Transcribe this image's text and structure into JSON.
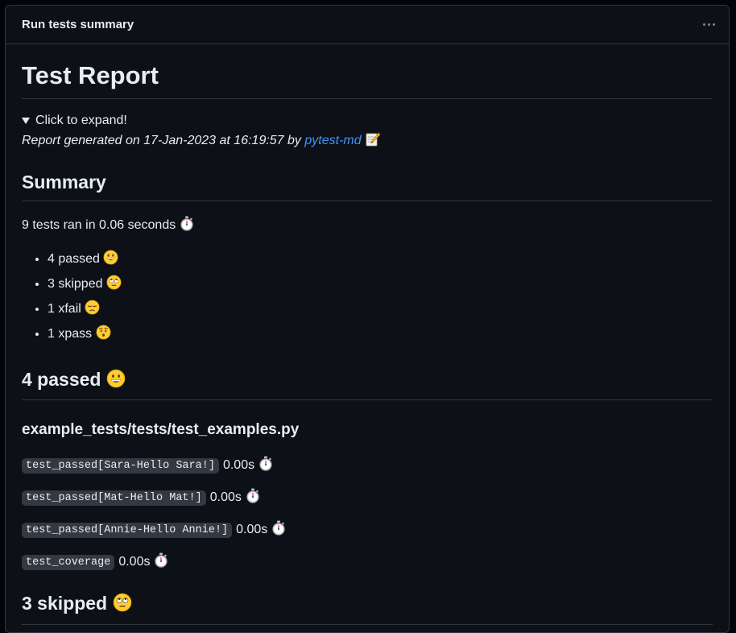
{
  "panel": {
    "title": "Run tests summary",
    "menu_icon": "kebab-horizontal-icon"
  },
  "report": {
    "title": "Test Report",
    "details_summary": "Click to expand!",
    "generated_prefix": "Report generated on 17-Jan-2023 at 16:19:57 by",
    "generated_link": "pytest-md",
    "generated_icon": "memo-icon"
  },
  "summary": {
    "heading": "Summary",
    "ran_text": "9 tests ran in 0.06 seconds",
    "items": [
      {
        "label": "4 passed",
        "icon": "grinning-face-icon"
      },
      {
        "label": "3 skipped",
        "icon": "rolling-eyes-face-icon"
      },
      {
        "label": "1 xfail",
        "icon": "pensive-face-icon"
      },
      {
        "label": "1 xpass",
        "icon": "hushed-face-icon"
      }
    ]
  },
  "passed": {
    "heading": "4 passed",
    "file": "example_tests/tests/test_examples.py",
    "tests": [
      {
        "name": "test_passed[Sara-Hello Sara!]",
        "duration": "0.00s"
      },
      {
        "name": "test_passed[Mat-Hello Mat!]",
        "duration": "0.00s"
      },
      {
        "name": "test_passed[Annie-Hello Annie!]",
        "duration": "0.00s"
      },
      {
        "name": "test_coverage",
        "duration": "0.00s"
      }
    ]
  },
  "skipped": {
    "heading": "3 skipped"
  }
}
